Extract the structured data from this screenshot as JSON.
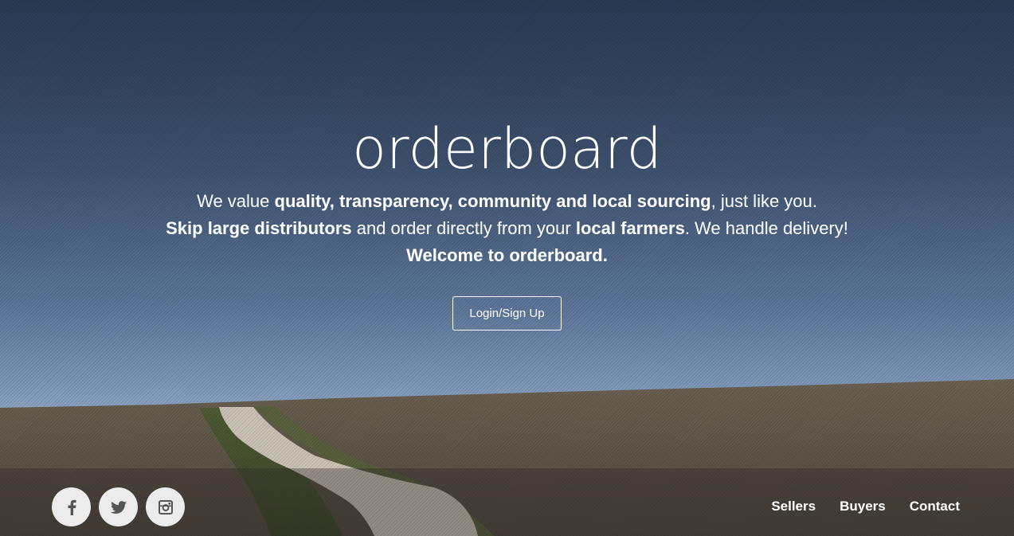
{
  "hero": {
    "title": "orderboard",
    "line1": {
      "pre": "We value ",
      "bold": "quality, transparency, community and local sourcing",
      "post": ", just like you."
    },
    "line2": {
      "bold1": "Skip large distributors",
      "mid": " and order directly from your ",
      "bold2": "local farmers",
      "post": ". We handle delivery!"
    },
    "line3": "Welcome to orderboard.",
    "cta_label": "Login/Sign Up"
  },
  "footer": {
    "socials": [
      {
        "name": "facebook-icon"
      },
      {
        "name": "twitter-icon"
      },
      {
        "name": "instagram-icon"
      }
    ],
    "nav": [
      "Sellers",
      "Buyers",
      "Contact"
    ]
  },
  "colors": {
    "sky_top": "#2b3951",
    "sky_horizon": "#8aa2c0",
    "field": "#5e5245",
    "road": "#c9c2b5",
    "social_bg": "#ececec",
    "icon": "#555555"
  }
}
